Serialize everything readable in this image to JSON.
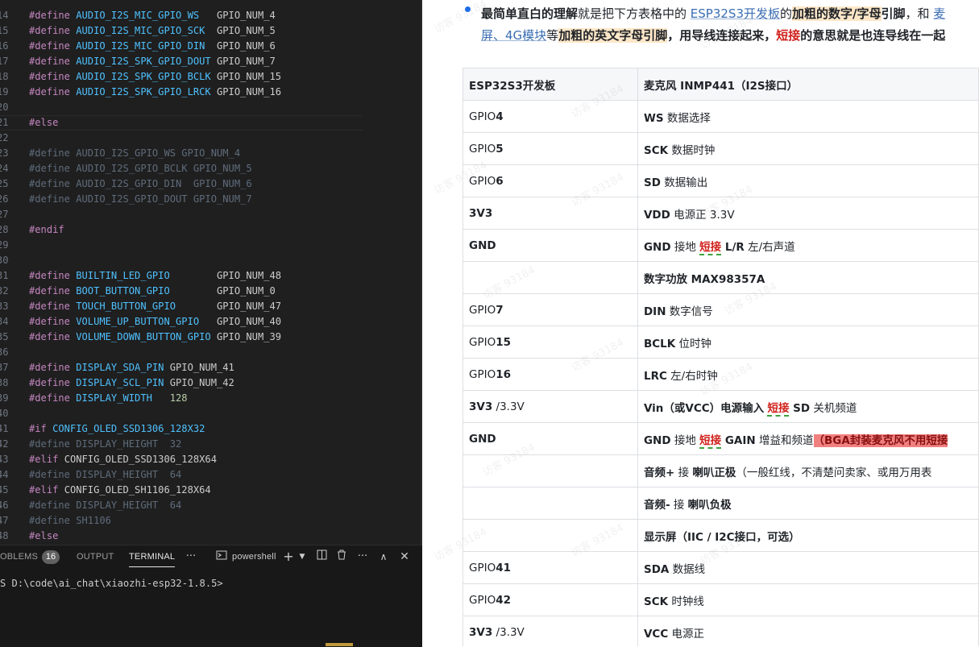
{
  "editor": {
    "lines": [
      {
        "n": "14",
        "kw": "#define",
        "id": "AUDIO_I2S_MIC_GPIO_WS  ",
        "val": " GPIO_NUM_4",
        "dim": false
      },
      {
        "n": "15",
        "kw": "#define",
        "id": "AUDIO_I2S_MIC_GPIO_SCK ",
        "val": " GPIO_NUM_5",
        "dim": false
      },
      {
        "n": "16",
        "kw": "#define",
        "id": "AUDIO_I2S_MIC_GPIO_DIN ",
        "val": " GPIO_NUM_6",
        "dim": false
      },
      {
        "n": "17",
        "kw": "#define",
        "id": "AUDIO_I2S_SPK_GPIO_DOUT",
        "val": " GPIO_NUM_7",
        "dim": false
      },
      {
        "n": "18",
        "kw": "#define",
        "id": "AUDIO_I2S_SPK_GPIO_BCLK",
        "val": " GPIO_NUM_15",
        "dim": false
      },
      {
        "n": "19",
        "kw": "#define",
        "id": "AUDIO_I2S_SPK_GPIO_LRCK",
        "val": " GPIO_NUM_16",
        "dim": false
      },
      {
        "n": "20",
        "kw": "",
        "id": "",
        "val": "",
        "dim": false
      },
      {
        "n": "21",
        "kw": "#else",
        "id": "",
        "val": "",
        "dim": false
      },
      {
        "n": "22",
        "kw": "",
        "id": "",
        "val": "",
        "dim": false
      },
      {
        "n": "23",
        "kw": "#define",
        "id": "AUDIO_I2S_GPIO_WS",
        "val": " GPIO_NUM_4",
        "dim": true
      },
      {
        "n": "24",
        "kw": "#define",
        "id": "AUDIO_I2S_GPIO_BCLK",
        "val": " GPIO_NUM_5",
        "dim": true
      },
      {
        "n": "25",
        "kw": "#define",
        "id": "AUDIO_I2S_GPIO_DIN ",
        "val": " GPIO_NUM_6",
        "dim": true
      },
      {
        "n": "26",
        "kw": "#define",
        "id": "AUDIO_I2S_GPIO_DOUT",
        "val": " GPIO_NUM_7",
        "dim": true
      },
      {
        "n": "27",
        "kw": "",
        "id": "",
        "val": "",
        "dim": false
      },
      {
        "n": "28",
        "kw": "#endif",
        "id": "",
        "val": "",
        "dim": false
      },
      {
        "n": "29",
        "kw": "",
        "id": "",
        "val": "",
        "dim": false
      },
      {
        "n": "30",
        "kw": "",
        "id": "",
        "val": "",
        "dim": false
      },
      {
        "n": "31",
        "kw": "#define",
        "id": "BUILTIN_LED_GPIO       ",
        "val": " GPIO_NUM_48",
        "dim": false
      },
      {
        "n": "32",
        "kw": "#define",
        "id": "BOOT_BUTTON_GPIO       ",
        "val": " GPIO_NUM_0",
        "dim": false
      },
      {
        "n": "33",
        "kw": "#define",
        "id": "TOUCH_BUTTON_GPIO      ",
        "val": " GPIO_NUM_47",
        "dim": false
      },
      {
        "n": "34",
        "kw": "#define",
        "id": "VOLUME_UP_BUTTON_GPIO  ",
        "val": " GPIO_NUM_40",
        "dim": false
      },
      {
        "n": "35",
        "kw": "#define",
        "id": "VOLUME_DOWN_BUTTON_GPIO",
        "val": " GPIO_NUM_39",
        "dim": false
      },
      {
        "n": "36",
        "kw": "",
        "id": "",
        "val": "",
        "dim": false
      },
      {
        "n": "37",
        "kw": "#define",
        "id": "DISPLAY_SDA_PIN",
        "val": " GPIO_NUM_41",
        "dim": false
      },
      {
        "n": "38",
        "kw": "#define",
        "id": "DISPLAY_SCL_PIN",
        "val": " GPIO_NUM_42",
        "dim": false
      },
      {
        "n": "39",
        "kw": "#define",
        "id": "DISPLAY_WIDTH  ",
        "num": " 128",
        "dim": false
      },
      {
        "n": "40",
        "kw": "",
        "id": "",
        "val": "",
        "dim": false
      },
      {
        "n": "41",
        "kw": "#if",
        "id": "CONFIG_OLED_SSD1306_128X32",
        "val": "",
        "dim": false
      },
      {
        "n": "42",
        "kw": "#define",
        "id": "DISPLAY_HEIGHT ",
        "num": " 32",
        "dim": true
      },
      {
        "n": "43",
        "kw": "#elif",
        "id": "",
        "val": "",
        "in": "CONFIG_OLED_SSD1306_128X64",
        "dim": false
      },
      {
        "n": "44",
        "kw": "#define",
        "id": "DISPLAY_HEIGHT ",
        "num": " 64",
        "dim": true
      },
      {
        "n": "45",
        "kw": "#elif",
        "id": "",
        "val": "",
        "in": "CONFIG_OLED_SH1106_128X64",
        "dim": false
      },
      {
        "n": "46",
        "kw": "#define",
        "id": "DISPLAY_HEIGHT ",
        "num": " 64",
        "dim": true
      },
      {
        "n": "47",
        "kw": "#define",
        "id": "SH1106",
        "val": "",
        "dim": true
      },
      {
        "n": "48",
        "kw": "#else",
        "id": "",
        "val": "",
        "dim": false
      }
    ]
  },
  "panel": {
    "tabs": {
      "problems": "OBLEMS",
      "problems_count": "16",
      "output": "OUTPUT",
      "terminal": "TERMINAL",
      "more": "···"
    },
    "shell_label": "powershell",
    "prompt": "S D:\\code\\ai_chat\\xiaozhi-esp32-1.8.5>"
  },
  "doc": {
    "intro_line1": {
      "a": "最简单直白的理解",
      "b": "就是把下方表格中的 ",
      "c": "ESP32S3开发板",
      "d": "的",
      "e": "加粗的数字/字母",
      "f": "引脚",
      "g": "，和 ",
      "h": "麦"
    },
    "intro_line2": {
      "a": "屏、4G模块",
      "b": "等",
      "c": "加粗的英文字母引脚",
      "d": "，用导线连接起来，",
      "e": "短接",
      "f": "的意思就是也连导线在一起"
    },
    "table": {
      "head": [
        "ESP32S3开发板",
        "麦克风 INMP441（I2S接口）"
      ],
      "rows": [
        {
          "pre": "GPIO",
          "bold": "4",
          "right_bold": "WS",
          "right": " 数据选择"
        },
        {
          "pre": "GPIO",
          "bold": "5",
          "right_bold": "SCK",
          "right": " 数据时钟"
        },
        {
          "pre": "GPIO",
          "bold": "6",
          "right_bold": "SD",
          "right": " 数据输出"
        },
        {
          "pre": "",
          "bold": "3V3",
          "right_bold": "VDD",
          "right": " 电源正 3.3V"
        },
        {
          "pre": "",
          "bold": "GND",
          "right_bold": "GND",
          "right": " 接地 ",
          "short": "短接",
          "tail_bold": " L/R",
          "tail": " 左/右声道"
        },
        {
          "pre": "",
          "bold": "",
          "right_bold": "数字功放 MAX98357A",
          "right": ""
        },
        {
          "pre": "GPIO",
          "bold": "7",
          "right_bold": "DIN",
          "right": " 数字信号"
        },
        {
          "pre": "GPIO",
          "bold": "15",
          "right_bold": "BCLK",
          "right": " 位时钟"
        },
        {
          "pre": "GPIO",
          "bold": "16",
          "right_bold": "LRC",
          "right": " 左/右时钟"
        },
        {
          "pre": "",
          "bold": "3V3",
          "post": " /3.3V",
          "right_bold": "Vin（或VCC）电源输入",
          "right": " ",
          "short": "短接",
          "tail_bold": " SD",
          "tail": " 关机频道"
        },
        {
          "pre": "",
          "bold": "GND",
          "right_bold": "GND",
          "right": " 接地 ",
          "short": "短接",
          "tail_bold": " GAIN",
          "tail": " 增益和频道",
          "redhl": "（BGA封装麦克风不用短接"
        },
        {
          "pre": "",
          "bold": "",
          "right_bold": "音频+",
          "right": " 接 ",
          "tail_bold": "喇叭正极",
          "tail": "（一般红线，不清楚问卖家、或用万用表"
        },
        {
          "pre": "",
          "bold": "",
          "right_bold": "音频-",
          "right": " 接 ",
          "tail_bold": "喇叭负极",
          "tail": ""
        },
        {
          "pre": "",
          "bold": "",
          "right_bold": "显示屏（IIC / I2C接口，可选）",
          "right": ""
        },
        {
          "pre": "GPIO",
          "bold": "41",
          "right_bold": "SDA",
          "right": "  数据线"
        },
        {
          "pre": "GPIO",
          "bold": "42",
          "right_bold": "SCK",
          "right": "  时钟线"
        },
        {
          "pre": "",
          "bold": "3V3",
          "post": " /3.3V",
          "right_bold": "VCC",
          "right": " 电源正"
        }
      ]
    },
    "watermark": "访客 93184"
  }
}
